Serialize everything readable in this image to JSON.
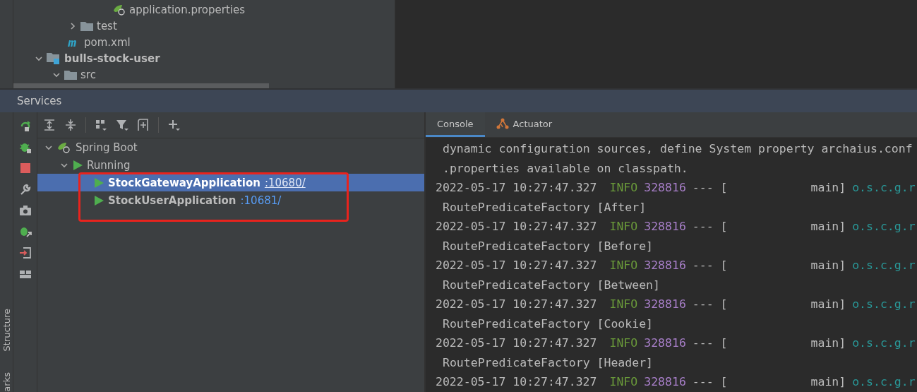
{
  "project_tree": [
    {
      "label": "application.properties",
      "kind": "spring-file",
      "bold": false
    },
    {
      "label": "test",
      "kind": "folder",
      "bold": false,
      "expanded": false
    },
    {
      "label": "pom.xml",
      "kind": "maven",
      "bold": false
    },
    {
      "label": "bulls-stock-user",
      "kind": "module",
      "bold": true,
      "expanded": true,
      "children": [
        {
          "label": "src",
          "kind": "folder",
          "bold": false,
          "expanded": true
        }
      ]
    }
  ],
  "services": {
    "title": "Services",
    "tree": [
      {
        "label": "Spring Boot",
        "expanded": true,
        "children": [
          {
            "label": "Running",
            "expanded": true,
            "children": [
              {
                "name": "StockGatewayApplication",
                "port": ":10680/",
                "selected": true
              },
              {
                "name": "StockUserApplication",
                "port": ":10681/",
                "selected": false
              }
            ]
          }
        ]
      }
    ],
    "tabs": [
      {
        "label": "Console",
        "selected": true
      },
      {
        "label": "Actuator",
        "selected": false
      }
    ],
    "console": [
      {
        "kind": "text",
        "text": "dynamic configuration sources, define System property archaius.conf"
      },
      {
        "kind": "text",
        "text": ".properties available on classpath."
      },
      {
        "kind": "log",
        "time": "2022-05-17 10:27:47.327",
        "level": "INFO",
        "pid": "328816",
        "sep": "--- [",
        "thread": "main]",
        "logger": "o.s.c.g.r"
      },
      {
        "kind": "text",
        "text": "RoutePredicateFactory [After]"
      },
      {
        "kind": "log",
        "time": "2022-05-17 10:27:47.327",
        "level": "INFO",
        "pid": "328816",
        "sep": "--- [",
        "thread": "main]",
        "logger": "o.s.c.g.r"
      },
      {
        "kind": "text",
        "text": "RoutePredicateFactory [Before]"
      },
      {
        "kind": "log",
        "time": "2022-05-17 10:27:47.327",
        "level": "INFO",
        "pid": "328816",
        "sep": "--- [",
        "thread": "main]",
        "logger": "o.s.c.g.r"
      },
      {
        "kind": "text",
        "text": "RoutePredicateFactory [Between]"
      },
      {
        "kind": "log",
        "time": "2022-05-17 10:27:47.327",
        "level": "INFO",
        "pid": "328816",
        "sep": "--- [",
        "thread": "main]",
        "logger": "o.s.c.g.r"
      },
      {
        "kind": "text",
        "text": "RoutePredicateFactory [Cookie]"
      },
      {
        "kind": "log",
        "time": "2022-05-17 10:27:47.327",
        "level": "INFO",
        "pid": "328816",
        "sep": "--- [",
        "thread": "main]",
        "logger": "o.s.c.g.r"
      },
      {
        "kind": "text",
        "text": "RoutePredicateFactory [Header]"
      },
      {
        "kind": "log",
        "time": "2022-05-17 10:27:47.327",
        "level": "INFO",
        "pid": "328816",
        "sep": "--- [",
        "thread": "main]",
        "logger": "o.s.c.g.r"
      }
    ]
  },
  "side_labels": [
    "Structure",
    "arks"
  ]
}
